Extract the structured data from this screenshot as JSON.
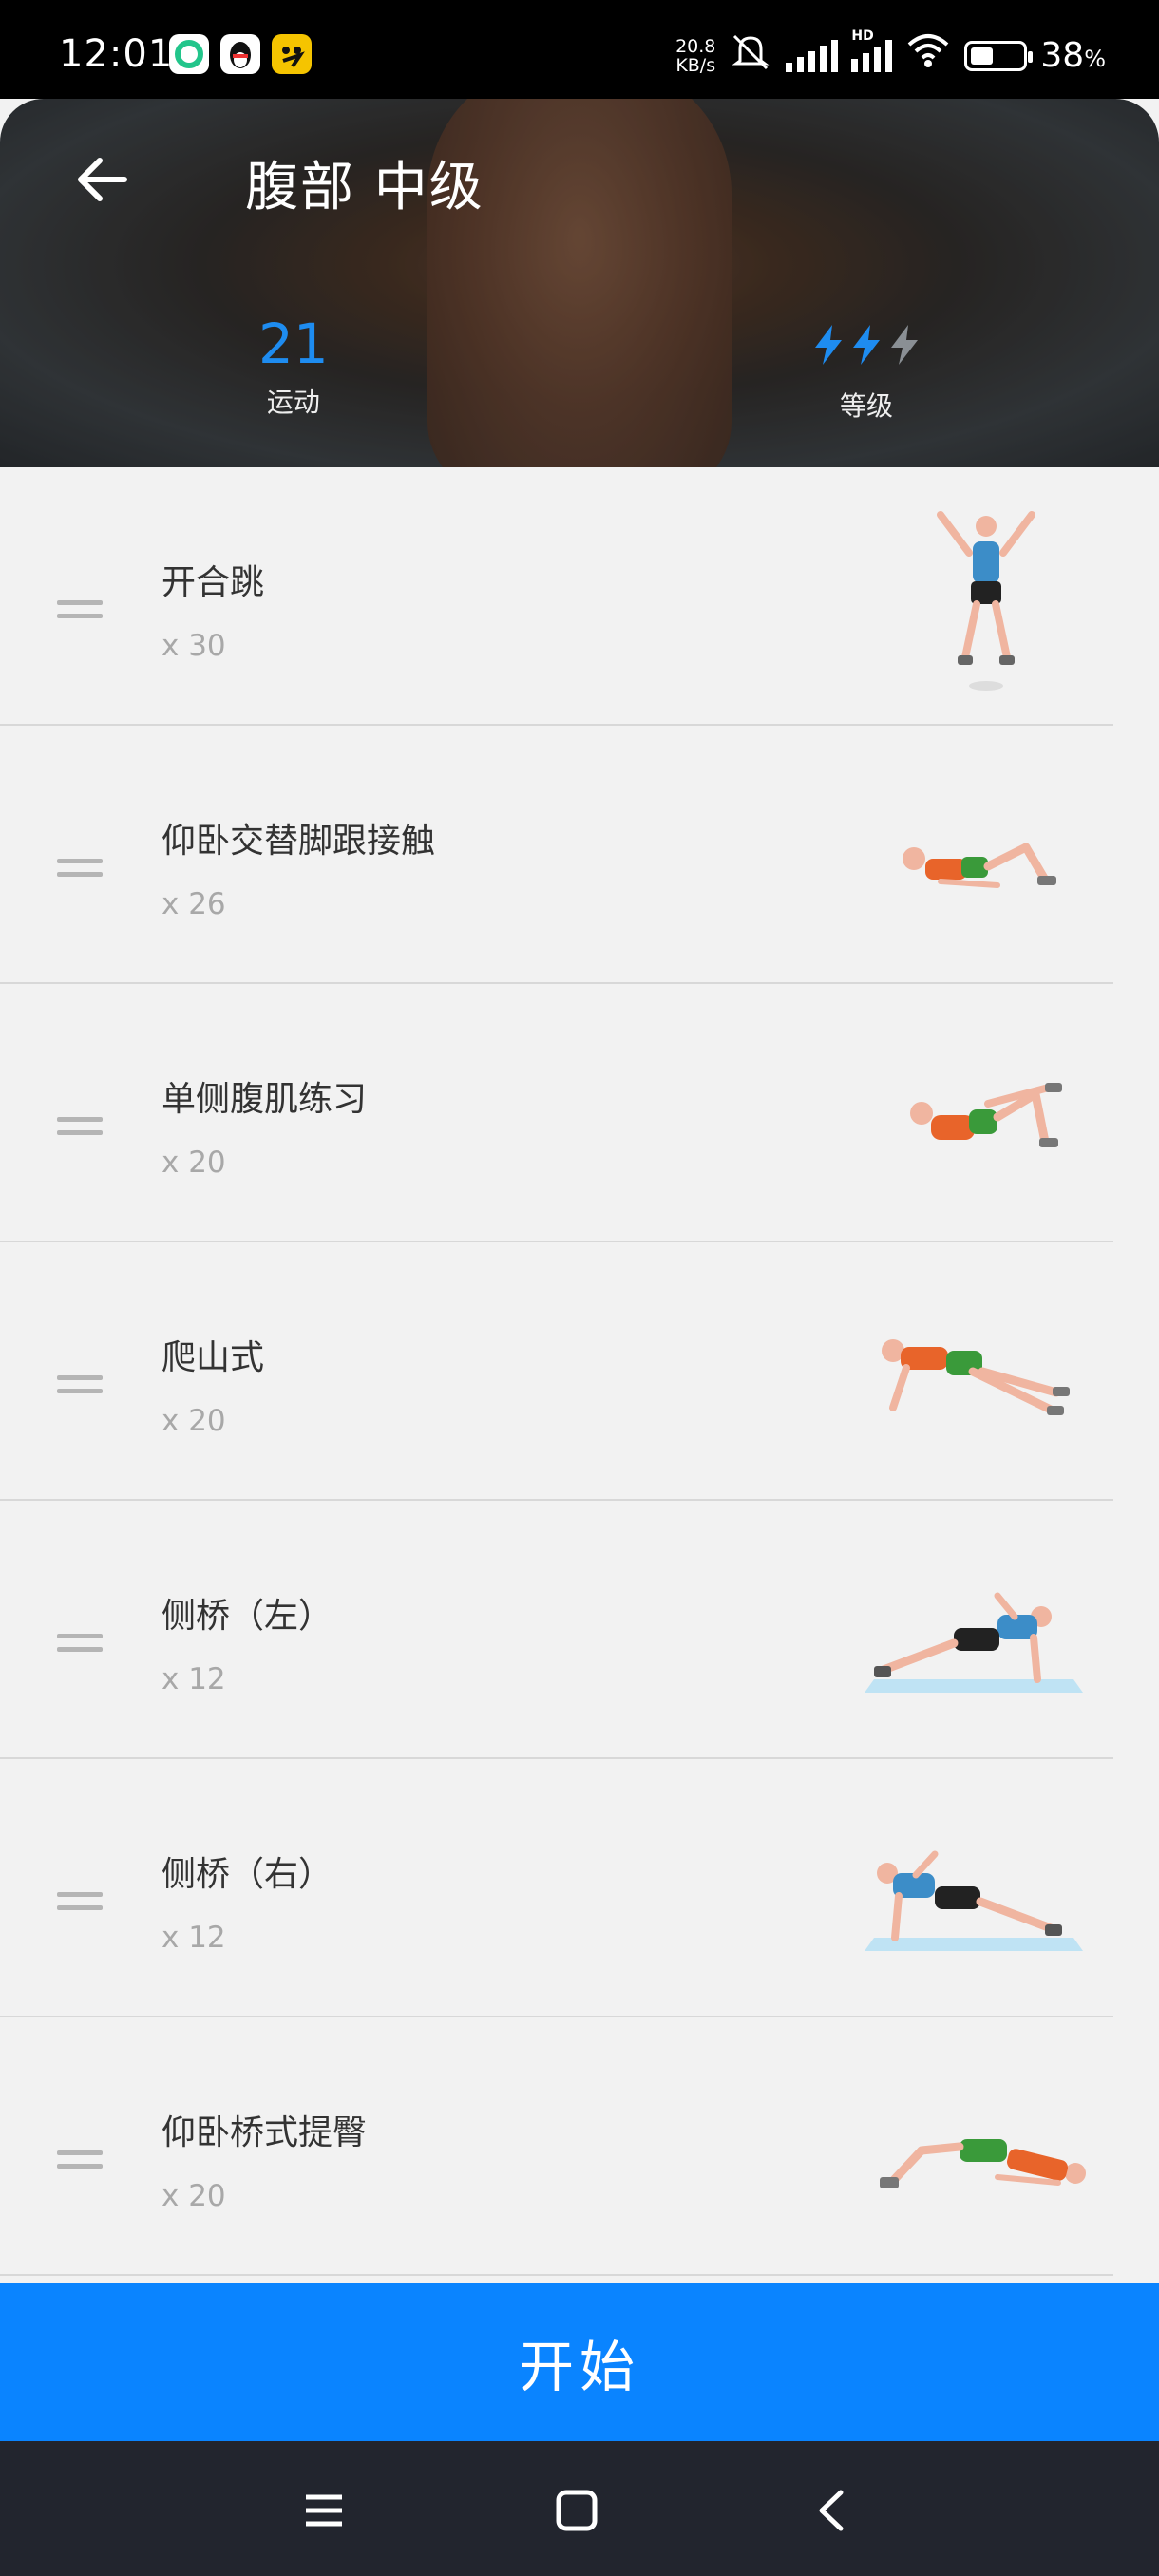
{
  "status_bar": {
    "time": "12:01",
    "net_speed_top": "20.8",
    "net_speed_bottom": "KB/s",
    "hd": "HD",
    "battery_percent": "38",
    "battery_unit": "%",
    "battery_level": 0.38,
    "app_icons": [
      "green-app-icon",
      "qq-penguin-icon",
      "yellow-app-icon"
    ]
  },
  "header": {
    "title": "腹部 中级",
    "exercise_count": "21",
    "exercise_count_label": "运动",
    "level_label": "等级",
    "level_active": 2,
    "level_max": 3,
    "accent_color": "#1e8cf0"
  },
  "exercises": [
    {
      "name": "开合跳",
      "reps": "x 30"
    },
    {
      "name": "仰卧交替脚跟接触",
      "reps": "x 26"
    },
    {
      "name": "单侧腹肌练习",
      "reps": "x 20"
    },
    {
      "name": "爬山式",
      "reps": "x 20"
    },
    {
      "name": "侧桥（左）",
      "reps": "x 12"
    },
    {
      "name": "侧桥（右）",
      "reps": "x 12"
    },
    {
      "name": "仰卧桥式提臀",
      "reps": "x 20"
    }
  ],
  "start_button": {
    "label": "开始",
    "color": "#0a84ff"
  },
  "nav": {
    "icons": [
      "menu-icon",
      "home-square-icon",
      "back-chevron-icon"
    ]
  }
}
